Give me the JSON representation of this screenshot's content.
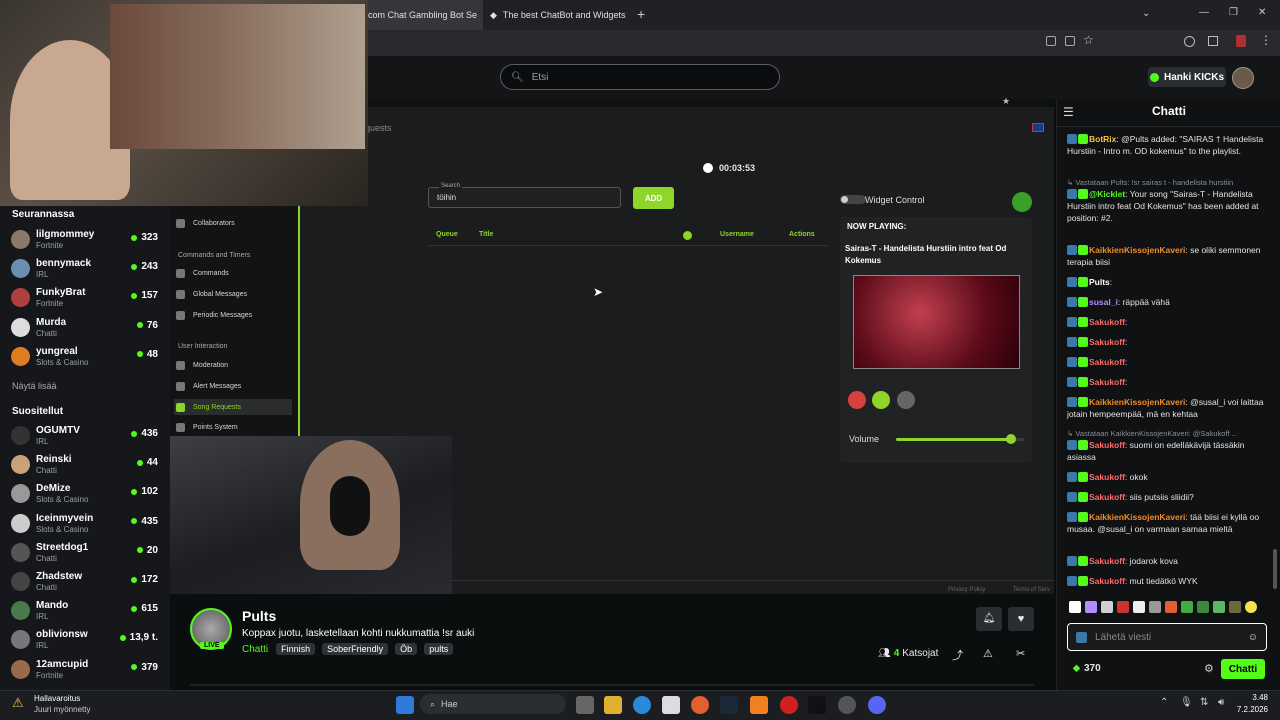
{
  "browser": {
    "tabs": [
      {
        "label": "com Chat Gambling Bot Se"
      },
      {
        "label": "The best ChatBot and Widgets"
      }
    ],
    "new_tab_label": "+"
  },
  "header": {
    "search_placeholder": "Etsi",
    "get_kicks_label": "Hanki KICKs"
  },
  "sidebar": {
    "following_title": "Seurannassa",
    "following": [
      {
        "name": "lilgmommey",
        "category": "Fortnite",
        "viewers": "323",
        "color": "#8a7a6a"
      },
      {
        "name": "bennymack",
        "category": "IRL",
        "viewers": "243",
        "color": "#6b8fb0"
      },
      {
        "name": "FunkyBrat",
        "category": "Fortnite",
        "viewers": "157",
        "color": "#b04040"
      },
      {
        "name": "Murda",
        "category": "Chatti",
        "viewers": "76",
        "color": "#ddd"
      },
      {
        "name": "yungreal",
        "category": "Slots & Casino",
        "viewers": "48",
        "color": "#e07b20"
      }
    ],
    "show_more": "Näytä lisää",
    "recommended_title": "Suositellut",
    "recommended": [
      {
        "name": "OGUMTV",
        "category": "IRL",
        "viewers": "436",
        "color": "#333"
      },
      {
        "name": "Reinski",
        "category": "Chatti",
        "viewers": "44",
        "color": "#c9a27a"
      },
      {
        "name": "DeMize",
        "category": "Slots & Casino",
        "viewers": "102",
        "color": "#999"
      },
      {
        "name": "Iceinmyvein",
        "category": "Slots & Casino",
        "viewers": "435",
        "color": "#ccc"
      },
      {
        "name": "Streetdog1",
        "category": "Chatti",
        "viewers": "20",
        "color": "#555"
      },
      {
        "name": "Zhadstew",
        "category": "Chatti",
        "viewers": "172",
        "color": "#444"
      },
      {
        "name": "Mando",
        "category": "IRL",
        "viewers": "615",
        "color": "#4a7a4a"
      },
      {
        "name": "oblivionsw",
        "category": "IRL",
        "viewers": "13,9 t.",
        "color": "#777"
      },
      {
        "name": "12amcupid",
        "category": "Fortnite",
        "viewers": "379",
        "color": "#9a6a4a"
      }
    ]
  },
  "botpanel": {
    "breadcrumb": "equests",
    "menu": [
      {
        "label": "Collaborators"
      },
      {
        "section": "Commands and Timers"
      },
      {
        "label": "Commands"
      },
      {
        "label": "Global Messages"
      },
      {
        "label": "Periodic Messages"
      },
      {
        "section": "User Interaction"
      },
      {
        "label": "Moderation"
      },
      {
        "label": "Alert Messages"
      },
      {
        "label": "Song Requests"
      },
      {
        "label": "Points System"
      }
    ],
    "timer": "00:03:53",
    "search_label": "Search",
    "search_value": "töihin",
    "add_label": "ADD",
    "columns": [
      "Queue",
      "Title",
      "Username",
      "Actions"
    ],
    "widget_control_label": "Widget Control",
    "now_playing_label": "NOW PLAYING:",
    "now_playing_title": "Sairas-T - Handelista Hurstiin intro feat Od Kokemus",
    "volume_label": "Volume",
    "volume_level": 0.9,
    "footer_links": [
      "Privacy Policy",
      "Terms of Serv"
    ]
  },
  "stream": {
    "channel_name": "Pults",
    "live_badge": "LIVE",
    "title": "Koppax juotu, lasketellaan kohti nukkumattia !sr auki",
    "category": "Chatti",
    "tags": [
      "Finnish",
      "SoberFriendly",
      "Öb",
      "pults"
    ],
    "viewers": "4",
    "viewers_label": "Katsojat"
  },
  "chat": {
    "title": "Chatti",
    "messages": [
      {
        "user": "BotRix",
        "color": "#f5c542",
        "text": ": @Pults added: \"SAIRAS † Handelista Hurstiin - Intro m. OD kokemus\" to the playlist.",
        "lines": 3
      },
      {
        "reply": "Vastataan Pults: !sr sairas t - handelista hurstiin"
      },
      {
        "user": "@Kicklet",
        "color": "#53fc18",
        "text": ": Your song \"Sairas-T - Handelista Hurstiin intro feat Od Kokemus\" has been added at position: #2.",
        "lines": 4
      },
      {
        "user": "KaikkienKissojenKaveri",
        "color": "#f28c28",
        "text": ": se oliki semmonen terapia biisi",
        "lines": 2
      },
      {
        "user": "Pults",
        "color": "#ffffff",
        "text": ":",
        "lines": 1,
        "h": 20
      },
      {
        "user": "susal_i",
        "color": "#b58cff",
        "text": ": räppää vähä",
        "lines": 1,
        "h": 20
      },
      {
        "user": "Sakukoff",
        "color": "#ff6b6b",
        "text": ":",
        "lines": 1,
        "h": 20
      },
      {
        "user": "Sakukoff",
        "color": "#ff6b6b",
        "text": ":",
        "lines": 1,
        "h": 20
      },
      {
        "user": "Sakukoff",
        "color": "#ff6b6b",
        "text": ":",
        "lines": 1,
        "h": 20
      },
      {
        "user": "Sakukoff",
        "color": "#ff6b6b",
        "text": ":",
        "lines": 1,
        "h": 20
      },
      {
        "user": "KaikkienKissojenKaveri",
        "color": "#f28c28",
        "text": ": @susal_i voi laittaa jotain hempeempää, mä en kehtaa",
        "lines": 2
      },
      {
        "reply": "Vastataan KaikkienKissojenKaveri: @Sakukoff ..."
      },
      {
        "user": "Sakukoff",
        "color": "#ff6b6b",
        "text": ": suomi on edelläkävijä tässäkin asiassa",
        "lines": 2
      },
      {
        "user": "Sakukoff",
        "color": "#ff6b6b",
        "text": ": okok",
        "lines": 1,
        "h": 20
      },
      {
        "user": "Sakukoff",
        "color": "#ff6b6b",
        "text": ": siis putsiis sliidii?",
        "lines": 1,
        "h": 20
      },
      {
        "user": "KaikkienKissojenKaveri",
        "color": "#f28c28",
        "text": ": tää biisi ei kyllä oo musaa. @susal_i on varmaan samaa mieltä",
        "lines": 3
      },
      {
        "user": "Sakukoff",
        "color": "#ff6b6b",
        "text": ": jodarok kova",
        "lines": 1,
        "h": 20
      },
      {
        "user": "Sakukoff",
        "color": "#ff6b6b",
        "text": ": mut tiedätkö WYK",
        "lines": 1,
        "h": 20
      }
    ],
    "input_placeholder": "Lähetä viesti",
    "points": "370",
    "send_label": "Chatti"
  },
  "taskbar": {
    "notification_title": "Hallavaroitus",
    "notification_sub": "Juuri myönnetty",
    "search_label": "Hae",
    "time": "3.48",
    "date": "7.2.2026"
  }
}
